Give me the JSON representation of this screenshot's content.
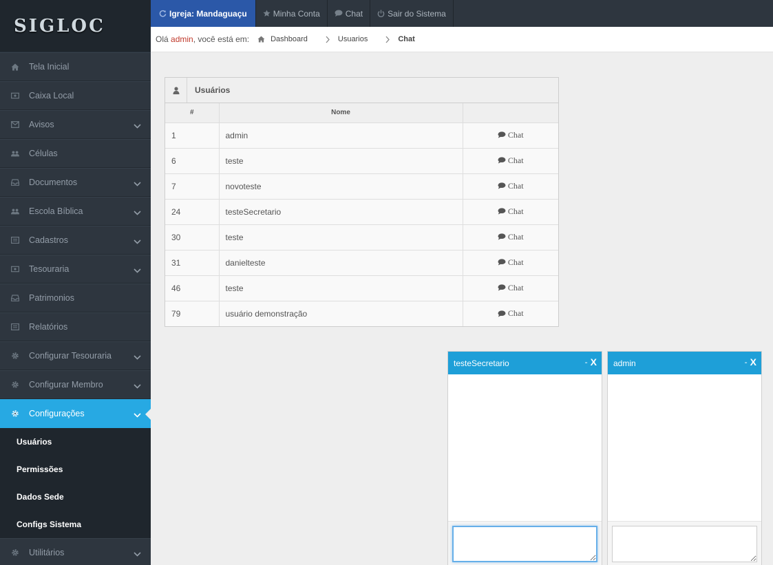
{
  "app": {
    "logo_text": "SIGLOC"
  },
  "sidebar": {
    "items": [
      {
        "label": "Tela Inicial",
        "icon": "home-icon",
        "chevron": false
      },
      {
        "label": "Caixa Local",
        "icon": "money-icon",
        "chevron": false
      },
      {
        "label": "Avisos",
        "icon": "envelope-icon",
        "chevron": true
      },
      {
        "label": "Células",
        "icon": "group-icon",
        "chevron": false
      },
      {
        "label": "Documentos",
        "icon": "inbox-icon",
        "chevron": true
      },
      {
        "label": "Escola Bíblica",
        "icon": "group-icon",
        "chevron": true
      },
      {
        "label": "Cadastros",
        "icon": "list-icon",
        "chevron": true
      },
      {
        "label": "Tesouraria",
        "icon": "money-icon",
        "chevron": true
      },
      {
        "label": "Patrimonios",
        "icon": "inbox-icon",
        "chevron": false
      },
      {
        "label": "Relatórios",
        "icon": "list-icon",
        "chevron": false
      },
      {
        "label": "Configurar Tesouraria",
        "icon": "gear-icon",
        "chevron": true
      },
      {
        "label": "Configurar Membro",
        "icon": "gear-icon",
        "chevron": true
      },
      {
        "label": "Configurações",
        "icon": "gear-icon",
        "chevron": true,
        "active": true
      }
    ],
    "subitems": [
      "Usuários",
      "Permissões",
      "Dados Sede",
      "Configs Sistema"
    ],
    "bottom_item": {
      "label": "Utilitários",
      "icon": "gear-icon",
      "chevron": true
    }
  },
  "topbar": {
    "church_label": "Igreja:",
    "church_name": "Mandaguaçu",
    "my_account": "Minha Conta",
    "chat": "Chat",
    "logout": "Sair do Sistema"
  },
  "breadcrumb": {
    "greeting_prefix": "Olá",
    "user": "admin",
    "greeting_suffix": ", você está em:",
    "items": [
      "Dashboard",
      "Usuarios",
      "Chat"
    ]
  },
  "users_widget": {
    "title": "Usuários",
    "columns": [
      "#",
      "Nome",
      ""
    ],
    "chat_label": "Chat",
    "rows": [
      {
        "id": "1",
        "name": "admin"
      },
      {
        "id": "6",
        "name": "teste"
      },
      {
        "id": "7",
        "name": "novoteste"
      },
      {
        "id": "24",
        "name": "testeSecretario"
      },
      {
        "id": "30",
        "name": "teste"
      },
      {
        "id": "31",
        "name": "danielteste"
      },
      {
        "id": "46",
        "name": "teste"
      },
      {
        "id": "79",
        "name": "usuário demonstração"
      }
    ]
  },
  "chat_windows": [
    {
      "title": "testeSecretario",
      "minimize": "-",
      "close": "X",
      "input_value": ""
    },
    {
      "title": "admin",
      "minimize": "-",
      "close": "X",
      "input_value": ""
    }
  ],
  "colors": {
    "sidebar_bg": "#2e363f",
    "active_blue": "#27a9e3",
    "church_blue": "#2b58a8",
    "chat_header": "#1e9fd8",
    "user_red": "#c0392b"
  }
}
